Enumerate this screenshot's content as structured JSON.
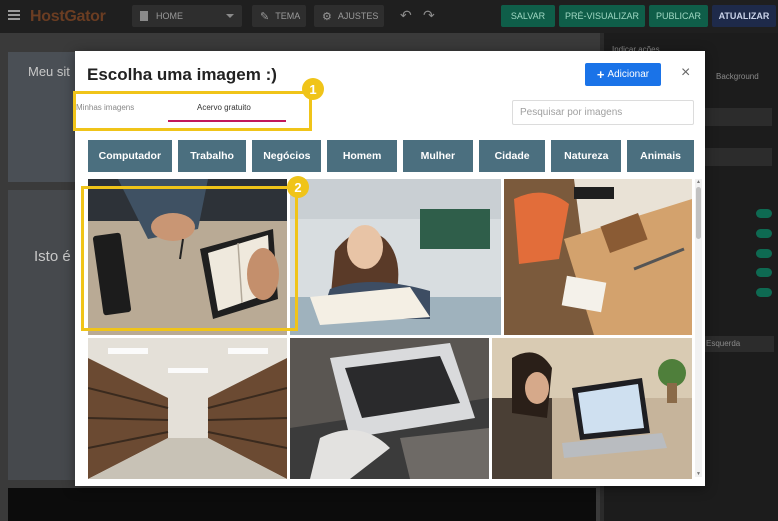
{
  "editor": {
    "brand": "HostGator",
    "page_select": "HOME",
    "theme_label": "TEMA",
    "settings_label": "AJUSTES",
    "save_label": "SALVAR",
    "preview_label": "PRÉ-VISUALIZAR",
    "publish_label": "PUBLICAR",
    "update_label": "ATUALIZAR",
    "site_title_fragment": "Meu sit",
    "site_text_fragment": "Isto é",
    "panel_tab_1": "Indicar ações",
    "panel_tab_2": "Background",
    "panel_select_value": "Esquerda"
  },
  "modal": {
    "title": "Escolha uma imagem :)",
    "add_label": "Adicionar",
    "close_symbol": "×",
    "tabs": [
      {
        "label": "Minhas imagens",
        "active": false
      },
      {
        "label": "Acervo gratuito",
        "active": true
      }
    ],
    "search_placeholder": "Pesquisar por imagens",
    "categories": [
      "Computador",
      "Trabalho",
      "Negócios",
      "Homem",
      "Mulher",
      "Cidade",
      "Natureza",
      "Animais"
    ]
  },
  "annotations": {
    "badge_1": "1",
    "badge_2": "2",
    "color": "#f0c419"
  },
  "colors": {
    "accent_blue": "#1a73e8",
    "category_bg": "#4b6f7f",
    "tab_underline": "#c2185b",
    "action_green": "#0f5e49"
  }
}
